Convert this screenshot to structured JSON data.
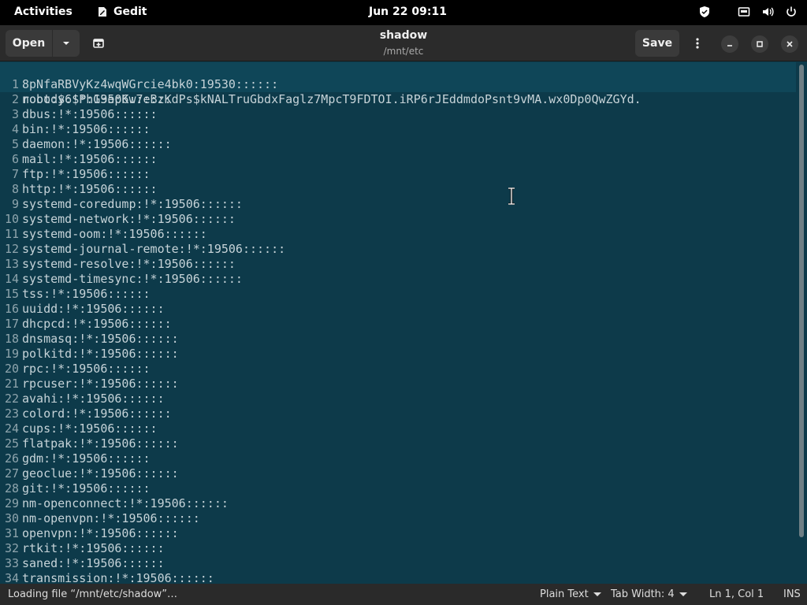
{
  "topbar": {
    "activities": "Activities",
    "app_name": "Gedit",
    "clock": "Jun 22  09:11"
  },
  "headerbar": {
    "open_label": "Open",
    "title": "shadow",
    "subtitle": "/mnt/etc",
    "save_label": "Save"
  },
  "editor": {
    "current_line": {
      "num": "1",
      "text_a": "root:$6$PhG3epKw7eBzKdPs$kNALTruGbdxFaglz7MpcT9FDTOI.iRP6rJEddmdoPsnt9vMA.wx0Dp0QwZGYd.",
      "text_b": "8pNfaRBVyKz4wqWGrcie4bk0:19530::::::"
    },
    "lines": [
      {
        "num": "2",
        "text": "nobody:!*:19506::::::"
      },
      {
        "num": "3",
        "text": "dbus:!*:19506::::::"
      },
      {
        "num": "4",
        "text": "bin:!*:19506::::::"
      },
      {
        "num": "5",
        "text": "daemon:!*:19506::::::"
      },
      {
        "num": "6",
        "text": "mail:!*:19506::::::"
      },
      {
        "num": "7",
        "text": "ftp:!*:19506::::::"
      },
      {
        "num": "8",
        "text": "http:!*:19506::::::"
      },
      {
        "num": "9",
        "text": "systemd-coredump:!*:19506::::::"
      },
      {
        "num": "10",
        "text": "systemd-network:!*:19506::::::"
      },
      {
        "num": "11",
        "text": "systemd-oom:!*:19506::::::"
      },
      {
        "num": "12",
        "text": "systemd-journal-remote:!*:19506::::::"
      },
      {
        "num": "13",
        "text": "systemd-resolve:!*:19506::::::"
      },
      {
        "num": "14",
        "text": "systemd-timesync:!*:19506::::::"
      },
      {
        "num": "15",
        "text": "tss:!*:19506::::::"
      },
      {
        "num": "16",
        "text": "uuidd:!*:19506::::::"
      },
      {
        "num": "17",
        "text": "dhcpcd:!*:19506::::::"
      },
      {
        "num": "18",
        "text": "dnsmasq:!*:19506::::::"
      },
      {
        "num": "19",
        "text": "polkitd:!*:19506::::::"
      },
      {
        "num": "20",
        "text": "rpc:!*:19506::::::"
      },
      {
        "num": "21",
        "text": "rpcuser:!*:19506::::::"
      },
      {
        "num": "22",
        "text": "avahi:!*:19506::::::"
      },
      {
        "num": "23",
        "text": "colord:!*:19506::::::"
      },
      {
        "num": "24",
        "text": "cups:!*:19506::::::"
      },
      {
        "num": "25",
        "text": "flatpak:!*:19506::::::"
      },
      {
        "num": "26",
        "text": "gdm:!*:19506::::::"
      },
      {
        "num": "27",
        "text": "geoclue:!*:19506::::::"
      },
      {
        "num": "28",
        "text": "git:!*:19506::::::"
      },
      {
        "num": "29",
        "text": "nm-openconnect:!*:19506::::::"
      },
      {
        "num": "30",
        "text": "nm-openvpn:!*:19506::::::"
      },
      {
        "num": "31",
        "text": "openvpn:!*:19506::::::"
      },
      {
        "num": "32",
        "text": "rtkit:!*:19506::::::"
      },
      {
        "num": "33",
        "text": "saned:!*:19506::::::"
      },
      {
        "num": "34",
        "text": "transmission:!*:19506::::::"
      }
    ]
  },
  "statusbar": {
    "message": "Loading file “/mnt/etc/shadow”…",
    "language": "Plain Text",
    "tab_width": "Tab Width: 4",
    "position": "Ln 1, Col 1",
    "mode": "INS"
  },
  "colors": {
    "editor_bg": "#0d3a4a",
    "topbar_bg": "#000000",
    "headerbar_bg": "#2b2b2b"
  }
}
